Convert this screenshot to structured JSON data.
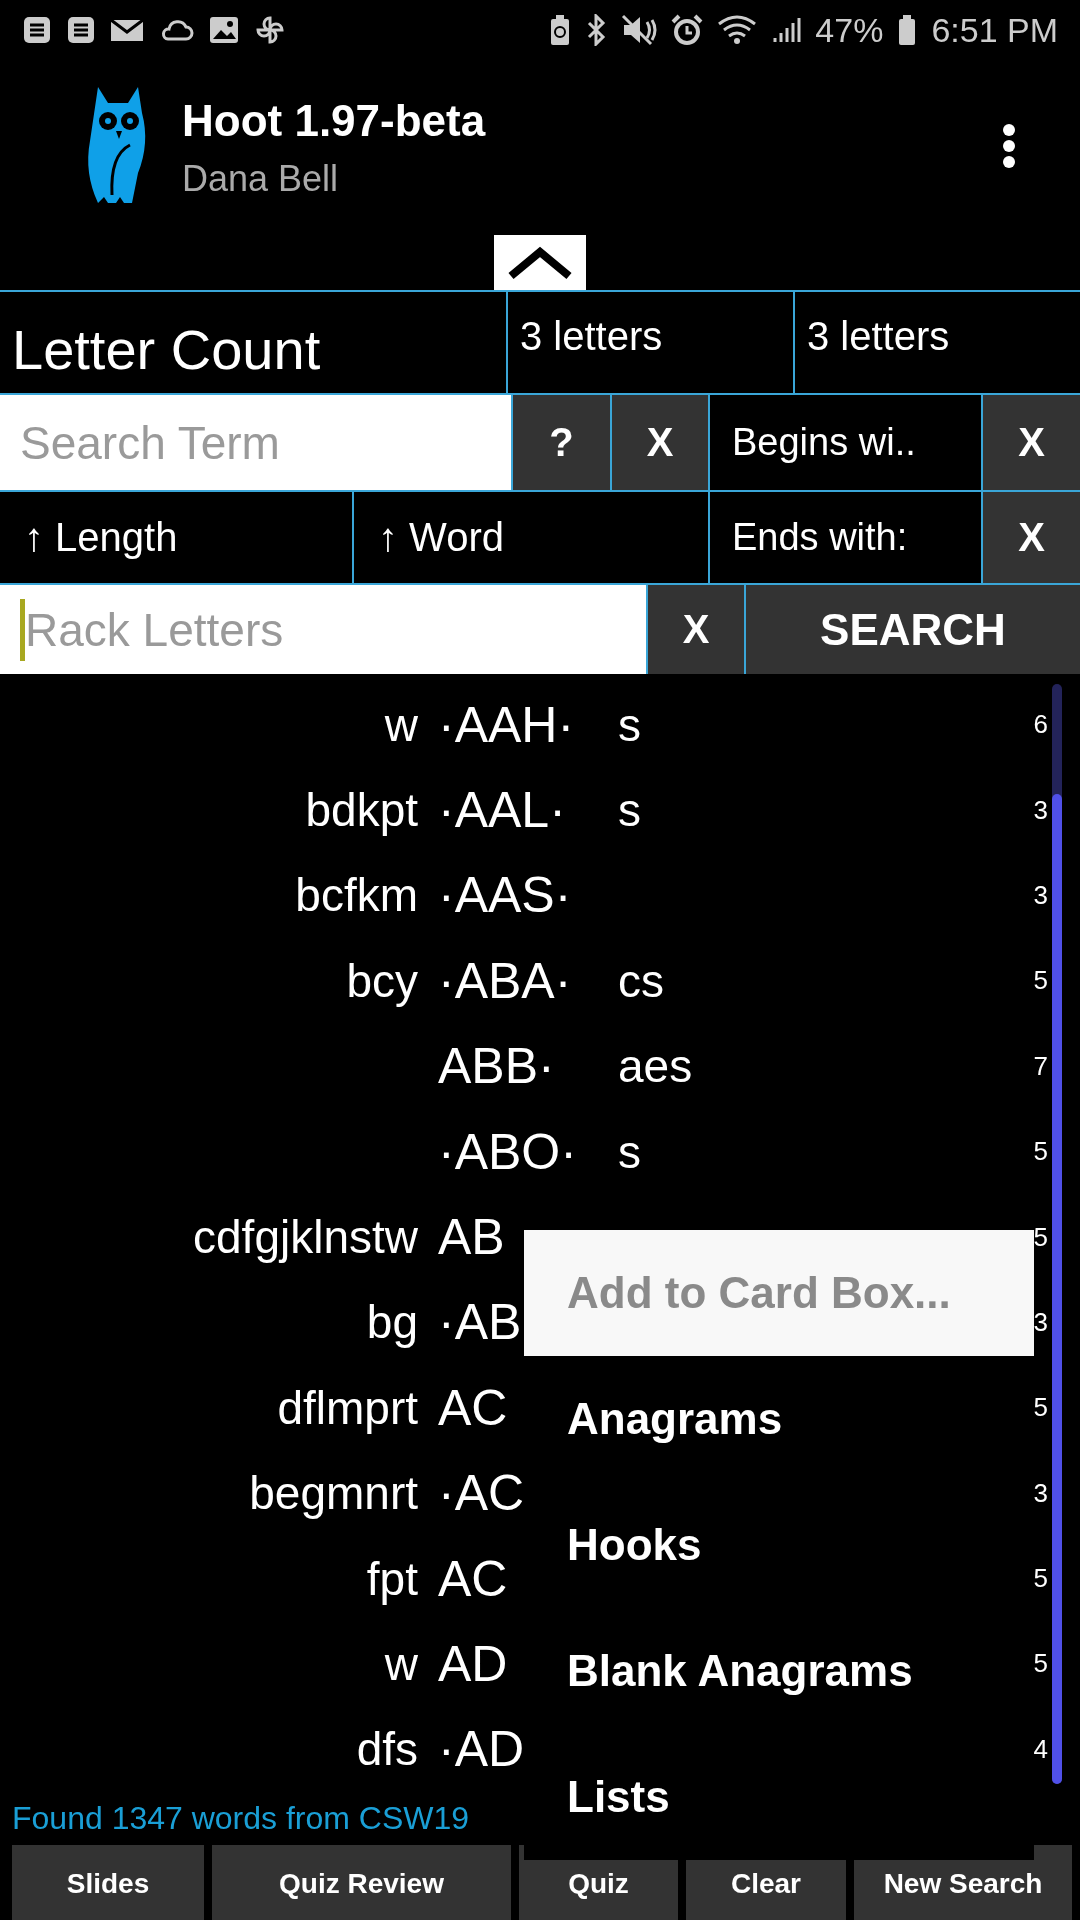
{
  "status_bar": {
    "battery": "47%",
    "time": "6:51 PM"
  },
  "app_bar": {
    "title": "Hoot 1.97-beta",
    "subtitle": "Dana Bell"
  },
  "controls": {
    "letter_count": {
      "label": "Letter Count",
      "from": "3 letters",
      "to": "3 letters"
    },
    "search_term": {
      "placeholder": "Search Term",
      "help_button": "?",
      "clear_button": "X"
    },
    "begins_with": {
      "label": "Begins wi..",
      "clear_button": "X"
    },
    "sort": [
      {
        "label": "↑ Length"
      },
      {
        "label": "↑ Word"
      }
    ],
    "ends_with": {
      "label": "Ends with:",
      "clear_button": "X"
    },
    "rack": {
      "placeholder": "Rack Letters",
      "focused": true,
      "clear_button": "X",
      "search_button": "SEARCH"
    }
  },
  "words": [
    {
      "front": "w",
      "word": "·AAH·",
      "back": "s",
      "count": "6"
    },
    {
      "front": "bdkpt",
      "word": "·AAL·",
      "back": "s",
      "count": "3"
    },
    {
      "front": "bcfkm",
      "word": "·AAS·",
      "count": "3"
    },
    {
      "front": "bcy",
      "word": "·ABA·",
      "back": "cs",
      "count": "5"
    },
    {
      "word": "ABB·",
      "back": "aes",
      "count": "7"
    },
    {
      "word": "·ABO·",
      "back": "s",
      "count": "5"
    },
    {
      "front": "cdfgjklnstw",
      "word": "AB",
      "count": "5"
    },
    {
      "front": "bg",
      "word": "·AB",
      "count": "3"
    },
    {
      "front": "dflmprt",
      "word": "AC",
      "count": "5"
    },
    {
      "front": "begmnrt",
      "word": "·AC",
      "count": "3"
    },
    {
      "front": "fpt",
      "word": "AC",
      "count": "5"
    },
    {
      "front": "w",
      "word": "AD",
      "count": "5"
    },
    {
      "front": "dfs",
      "word": "·AD",
      "count": "4"
    }
  ],
  "status": "Found 1347 words from CSW19",
  "bottom_buttons": [
    "Slides",
    "Quiz Review",
    "Quiz",
    "Clear",
    "New Search"
  ],
  "menu": [
    {
      "label": "Add to Card Box...",
      "highlighted": true
    },
    {
      "label": "Anagrams",
      "highlighted": false
    },
    {
      "label": "Hooks",
      "highlighted": false
    },
    {
      "label": "Blank Anagrams",
      "highlighted": false
    },
    {
      "label": "Lists",
      "highlighted": false
    }
  ]
}
